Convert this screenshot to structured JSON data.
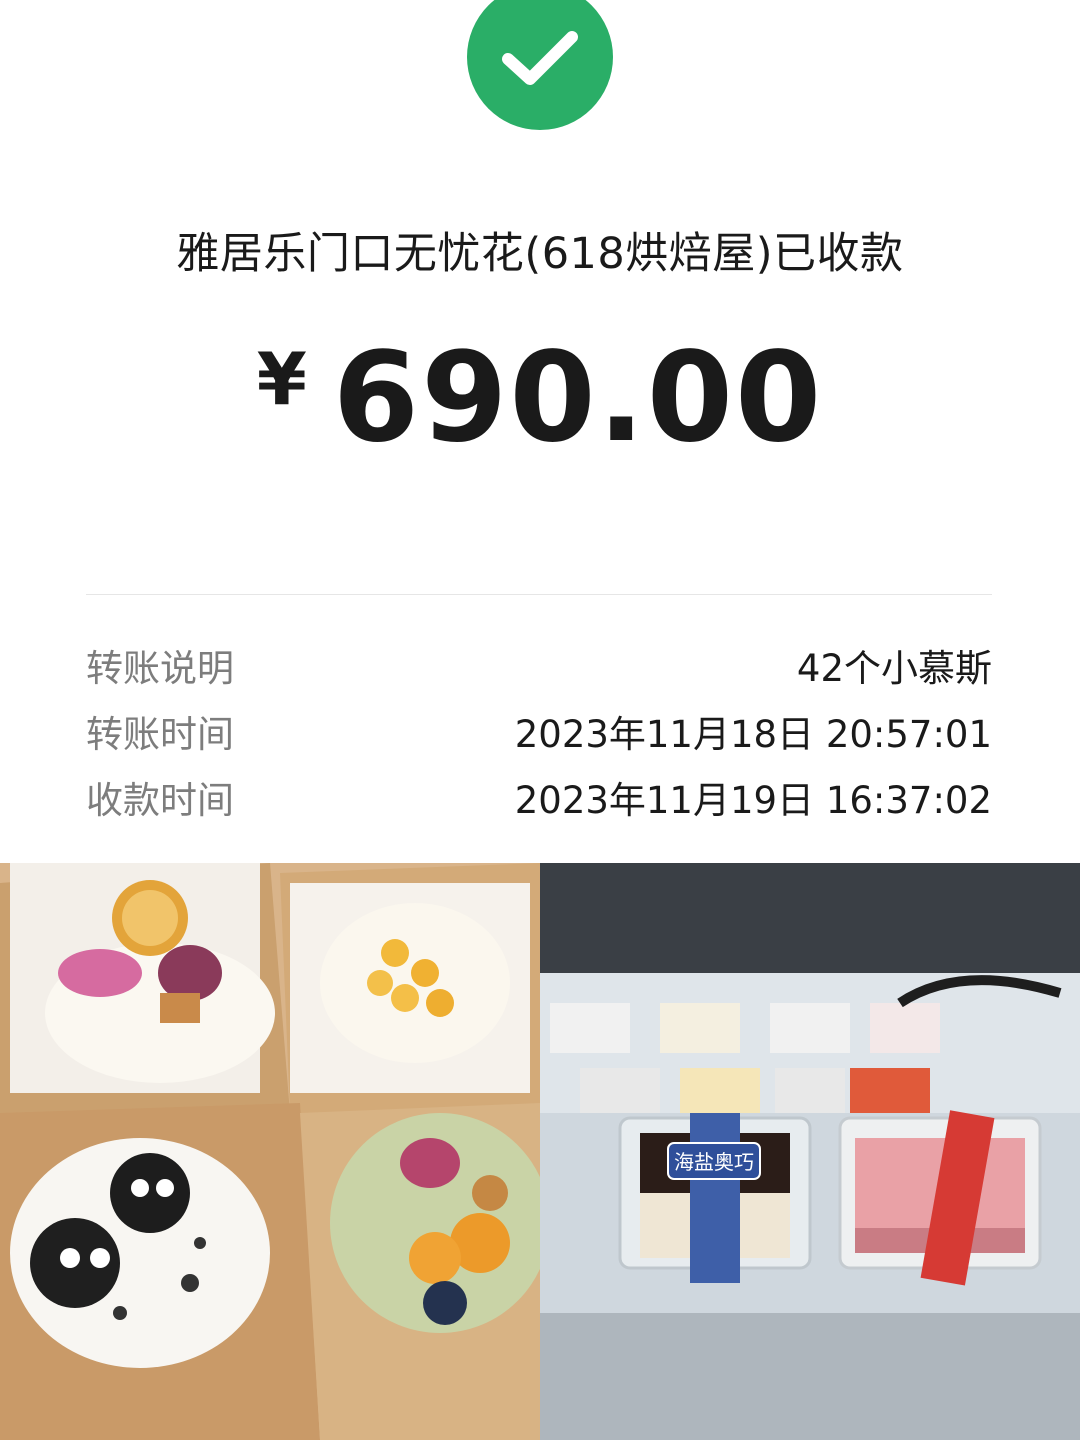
{
  "status": {
    "icon": "check-circle-icon",
    "color": "#2aae67"
  },
  "payee_text": "雅居乐门口无忧花(618烘焙屋)已收款",
  "amount": {
    "currency": "¥",
    "value": "690.00"
  },
  "details": [
    {
      "label": "转账说明",
      "value": "42个小慕斯"
    },
    {
      "label": "转账时间",
      "value": "2023年11月18日 20:57:01"
    },
    {
      "label": "收款时间",
      "value": "2023年11月19日 16:37:02"
    }
  ],
  "photos": {
    "left": {
      "subject": "four mini mousse cakes in paper wraps"
    },
    "right": {
      "subject": "cakes in a refrigerated display case",
      "label_text": "海盐奥巧"
    }
  }
}
